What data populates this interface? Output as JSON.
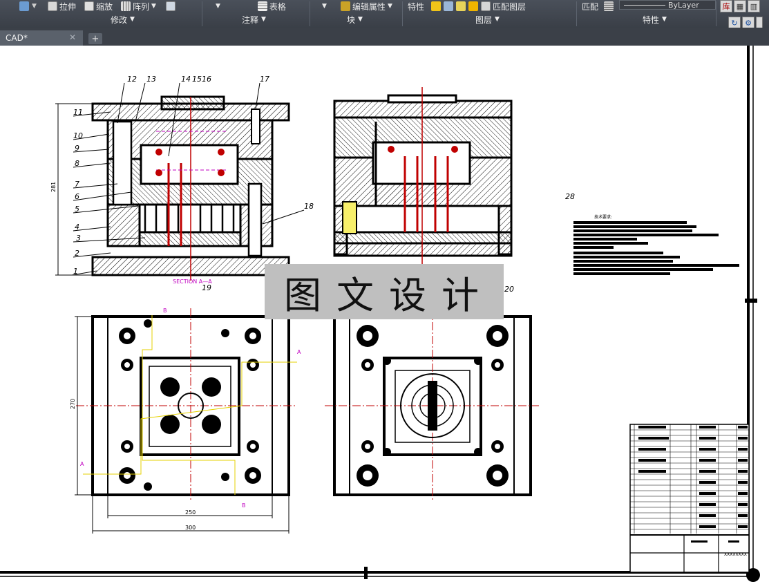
{
  "ribbon": {
    "modify": {
      "stretch": "拉伸",
      "scale": "缩放",
      "array": "阵列",
      "panel": "修改"
    },
    "annotation": {
      "table": "表格",
      "panel": "注释"
    },
    "block": {
      "edit_attributes": "编辑属性",
      "panel": "块"
    },
    "layers": {
      "properties": "特性",
      "match_layer": "匹配图层",
      "panel": "图层"
    },
    "properties": {
      "match": "匹配",
      "bylayer": "ByLayer",
      "panel": "特性"
    }
  },
  "tabs": {
    "active": "CAD*",
    "close": "✕",
    "add": "+"
  },
  "drawing": {
    "watermark": "图文设计",
    "section_label": "SECTION A—A",
    "balloons": [
      "12",
      "13",
      "14",
      "15",
      "16",
      "17",
      "11",
      "10",
      "9",
      "8",
      "7",
      "6",
      "5",
      "4",
      "3",
      "2",
      "1",
      "18",
      "19",
      "20"
    ],
    "note_number": "28",
    "tech_req_title": "技术要求:",
    "dims": {
      "height_left": "281",
      "height_plan": "270",
      "width_inner": "250",
      "width_outer": "300"
    },
    "section_letters": [
      "A",
      "B"
    ],
    "title_block_code": "XXXXXXXX"
  },
  "colors": {
    "accent_red": "#c00000",
    "section_magenta": "#c000c0",
    "yellow_line": "#e6d200",
    "ribbon_bg": "#40454d"
  }
}
